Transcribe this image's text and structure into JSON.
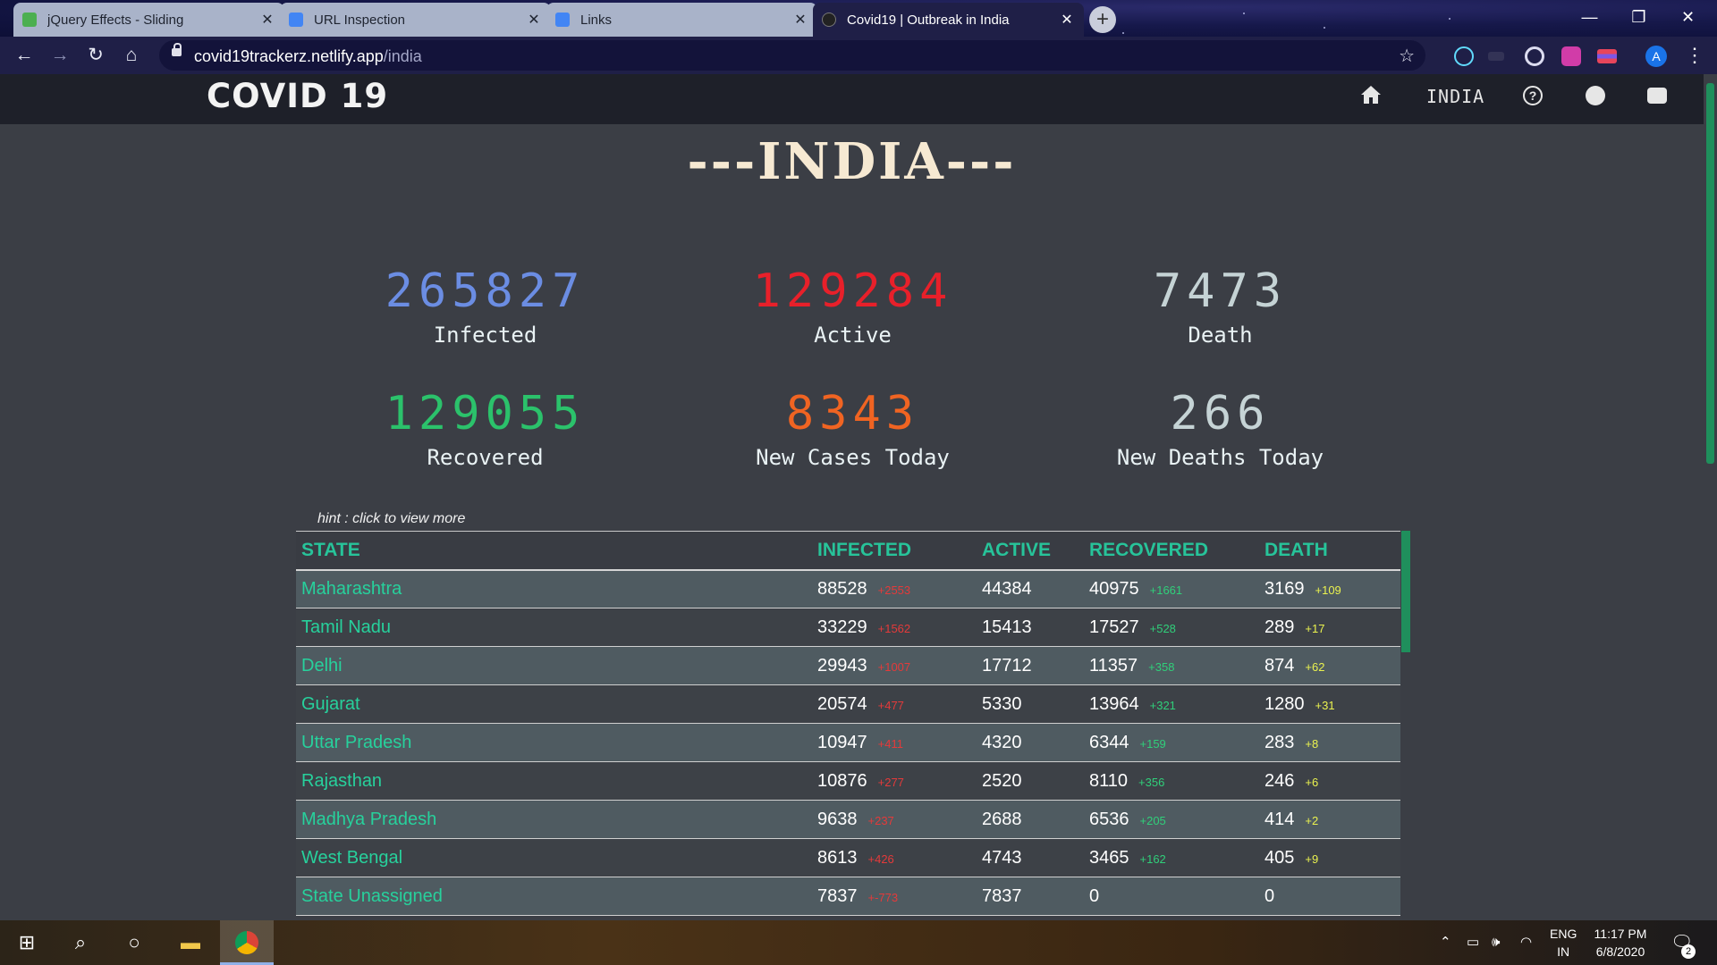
{
  "browser": {
    "tabs": [
      {
        "title": "jQuery Effects - Sliding",
        "favicon_color": "#4caf50",
        "active": false
      },
      {
        "title": "URL Inspection",
        "favicon_color": "#4285f4",
        "active": false
      },
      {
        "title": "Links",
        "favicon_color": "#4285f4",
        "active": false
      },
      {
        "title": "Covid19 | Outbreak in India",
        "favicon_color": "#222222",
        "active": true
      }
    ],
    "new_tab": "+",
    "url_host": "covid19trackerz.netlify.app",
    "url_path": "/india",
    "profile_initial": "A"
  },
  "site": {
    "brand": "COVID 19",
    "nav_country": "INDIA",
    "heading": "---INDIA---",
    "hint": "hint : click to view more"
  },
  "stats": [
    {
      "value": "265827",
      "label": "Infected",
      "color": "#6b8de3"
    },
    {
      "value": "129284",
      "label": "Active",
      "color": "#e8202a"
    },
    {
      "value": "7473",
      "label": "Death",
      "color": "#c5d3d5"
    },
    {
      "value": "129055",
      "label": "Recovered",
      "color": "#2bc26b"
    },
    {
      "value": "8343",
      "label": "New Cases Today",
      "color": "#f06422"
    },
    {
      "value": "266",
      "label": "New Deaths Today",
      "color": "#c5d3d5"
    }
  ],
  "table": {
    "headers": [
      "STATE",
      "INFECTED",
      "ACTIVE",
      "RECOVERED",
      "DEATH"
    ],
    "rows": [
      {
        "state": "Maharashtra",
        "infected": "88528",
        "infected_delta": "+2553",
        "active": "44384",
        "recovered": "40975",
        "recovered_delta": "+1661",
        "death": "3169",
        "death_delta": "+109"
      },
      {
        "state": "Tamil Nadu",
        "infected": "33229",
        "infected_delta": "+1562",
        "active": "15413",
        "recovered": "17527",
        "recovered_delta": "+528",
        "death": "289",
        "death_delta": "+17"
      },
      {
        "state": "Delhi",
        "infected": "29943",
        "infected_delta": "+1007",
        "active": "17712",
        "recovered": "11357",
        "recovered_delta": "+358",
        "death": "874",
        "death_delta": "+62"
      },
      {
        "state": "Gujarat",
        "infected": "20574",
        "infected_delta": "+477",
        "active": "5330",
        "recovered": "13964",
        "recovered_delta": "+321",
        "death": "1280",
        "death_delta": "+31"
      },
      {
        "state": "Uttar Pradesh",
        "infected": "10947",
        "infected_delta": "+411",
        "active": "4320",
        "recovered": "6344",
        "recovered_delta": "+159",
        "death": "283",
        "death_delta": "+8"
      },
      {
        "state": "Rajasthan",
        "infected": "10876",
        "infected_delta": "+277",
        "active": "2520",
        "recovered": "8110",
        "recovered_delta": "+356",
        "death": "246",
        "death_delta": "+6"
      },
      {
        "state": "Madhya Pradesh",
        "infected": "9638",
        "infected_delta": "+237",
        "active": "2688",
        "recovered": "6536",
        "recovered_delta": "+205",
        "death": "414",
        "death_delta": "+2"
      },
      {
        "state": "West Bengal",
        "infected": "8613",
        "infected_delta": "+426",
        "active": "4743",
        "recovered": "3465",
        "recovered_delta": "+162",
        "death": "405",
        "death_delta": "+9"
      },
      {
        "state": "State Unassigned",
        "infected": "7837",
        "infected_delta": "+-773",
        "active": "7837",
        "recovered": "0",
        "recovered_delta": "",
        "death": "0",
        "death_delta": ""
      }
    ]
  },
  "taskbar": {
    "lang_line1": "ENG",
    "lang_line2": "IN",
    "time": "11:17 PM",
    "date": "6/8/2020",
    "notification_count": "2"
  }
}
